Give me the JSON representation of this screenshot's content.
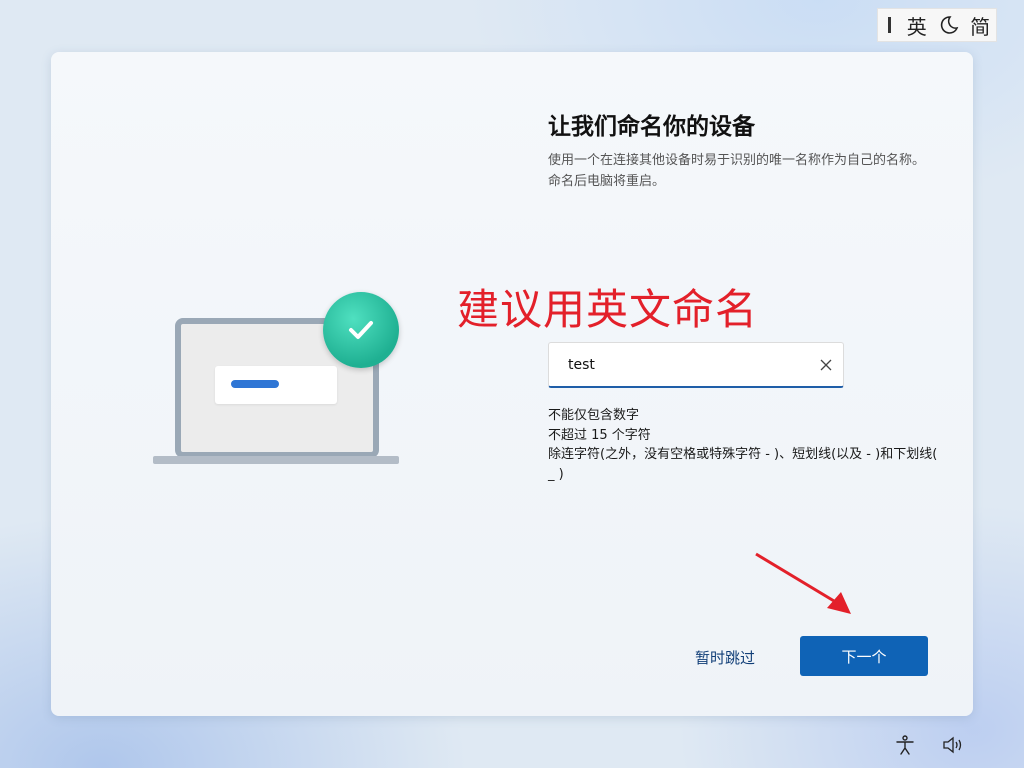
{
  "ime": {
    "lang_label": "英",
    "mode_label": "简"
  },
  "page": {
    "title": "让我们命名你的设备",
    "description": "使用一个在连接其他设备时易于识别的唯一名称作为自己的名称。命名后电脑将重启。",
    "annotation": "建议用英文命名"
  },
  "name_field": {
    "value": "test"
  },
  "rules": [
    "不能仅包含数字",
    "不超过 15 个字符",
    "除连字符(之外，没有空格或特殊字符 - )、短划线(以及 - )和下划线( _ )"
  ],
  "actions": {
    "skip_label": "暂时跳过",
    "next_label": "下一个"
  },
  "colors": {
    "accent": "#0f63b6",
    "annotation": "#e3202a",
    "check_badge": "#2cc7a3"
  },
  "icons": [
    "moon-icon",
    "checkmark-icon",
    "clear-icon",
    "accessibility-icon",
    "volume-icon"
  ]
}
